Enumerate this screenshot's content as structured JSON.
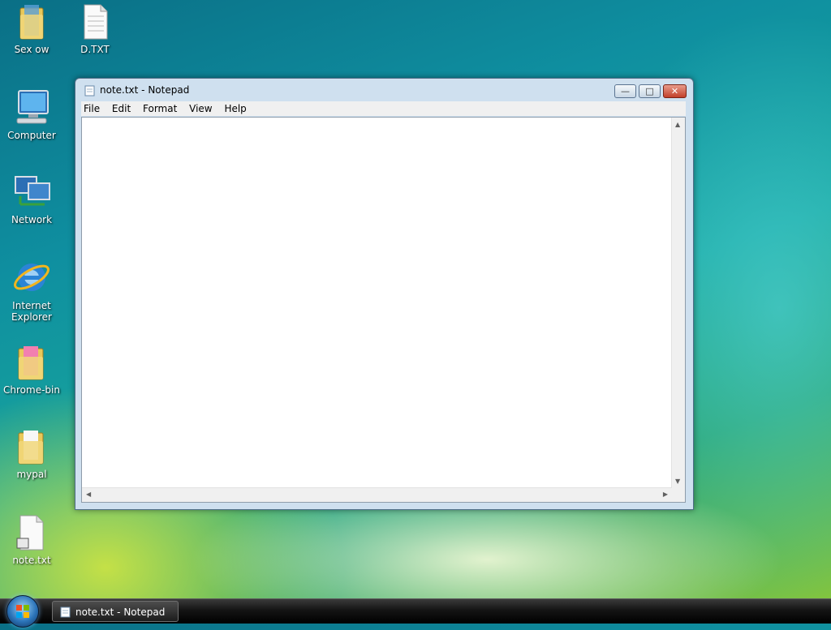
{
  "desktop": {
    "icons": [
      {
        "label": "Sex ow",
        "icon": "folder-icon"
      },
      {
        "label": "D.TXT",
        "icon": "text-file-icon"
      },
      {
        "label": "Computer",
        "icon": "computer-icon"
      },
      {
        "label": "Network",
        "icon": "network-icon"
      },
      {
        "label": "Internet Explorer",
        "icon": "internet-explorer-icon"
      },
      {
        "label": "Chrome-bin",
        "icon": "folder-icon"
      },
      {
        "label": "mypal",
        "icon": "folder-icon"
      },
      {
        "label": "note.txt",
        "icon": "text-file-icon"
      }
    ]
  },
  "window": {
    "title": "note.txt - Notepad",
    "menu": [
      "File",
      "Edit",
      "Format",
      "View",
      "Help"
    ],
    "content": ""
  },
  "taskbar": {
    "task_label": "note.txt - Notepad"
  },
  "colors": {
    "title_bar": "#cfe0ef",
    "close_button": "#c2402a",
    "taskbar": "#141414"
  }
}
